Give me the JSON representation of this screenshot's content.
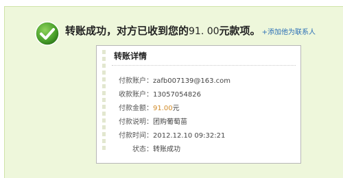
{
  "result": {
    "headline_prefix": "转账成功，对方已收到您的",
    "amount": "91. 00",
    "headline_suffix": "元款项。",
    "add_contact_link": "+添加他为联系人"
  },
  "details": {
    "title": "转账详情",
    "rows": [
      {
        "label": "付款账户：",
        "value": "zafb007139@163.com"
      },
      {
        "label": "收款账户：",
        "value": "13057054826"
      },
      {
        "label": "付款金额：",
        "value": "91.00",
        "unit": "元"
      },
      {
        "label": "付款说明：",
        "value": "团购葡萄苗"
      },
      {
        "label": "付款时间：",
        "value": "2012.12.10 09:32:21"
      },
      {
        "label": "状态：",
        "value": "转账成功"
      }
    ]
  },
  "icons": {
    "status": "success-check-icon"
  },
  "colors": {
    "panel_bg": "#eef7db",
    "check_green": "#4aa02c",
    "link_blue": "#2b6fb6",
    "amount_orange": "#d08a27"
  }
}
